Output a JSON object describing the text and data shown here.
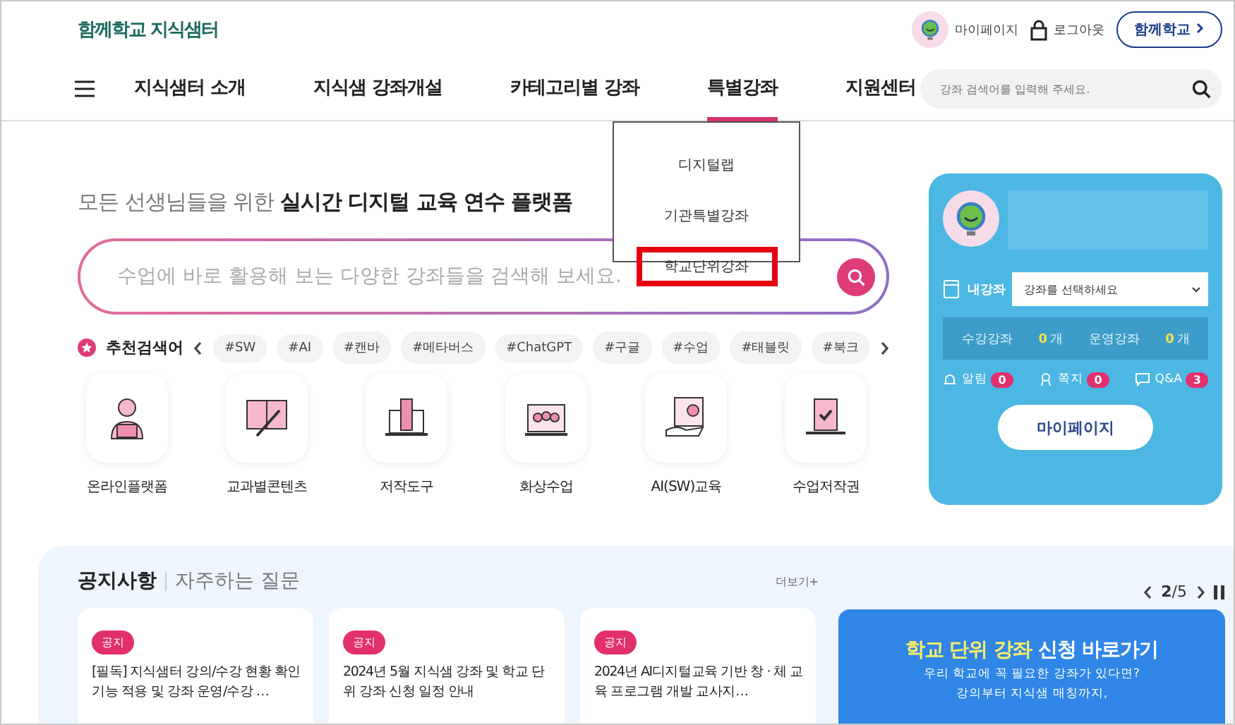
{
  "header": {
    "logo": "함께학교 지식샘터",
    "links": [
      {
        "label": "마이페이지",
        "kind": "avatar"
      },
      {
        "label": "로그아웃",
        "kind": "lock"
      }
    ],
    "partner_button": "함께학교"
  },
  "nav": {
    "items": [
      {
        "label": "지식샘터 소개",
        "selected": false
      },
      {
        "label": "지식샘 강좌개설",
        "selected": false
      },
      {
        "label": "카테고리별 강좌",
        "selected": false
      },
      {
        "label": "특별강좌",
        "selected": true
      },
      {
        "label": "지원센터",
        "selected": false
      }
    ],
    "search": {
      "placeholder": "강좌 검색어를 입력해 주세요."
    }
  },
  "dropdown": {
    "items": [
      {
        "label": "디지털랩",
        "highlighted": false
      },
      {
        "label": "기관특별강좌",
        "highlighted": false
      },
      {
        "label": "학교단위강좌",
        "highlighted": true
      }
    ]
  },
  "hero": {
    "headline": "모든 선생님들을 위한 **실시간 디지털 교육 연수 플랫폼**",
    "search": {
      "placeholder": "수업에 바로 활용해 보는 다양한 강좌들을 검색해 보세요."
    },
    "tags_label": "추천검색어",
    "tags": [
      "#SW",
      "#AI",
      "#캔바",
      "#메타버스",
      "#ChatGPT",
      "#구글",
      "#수업",
      "#태블릿",
      "#북크"
    ]
  },
  "categories": [
    {
      "label": "온라인플랫폼"
    },
    {
      "label": "교과별콘텐츠"
    },
    {
      "label": "저작도구"
    },
    {
      "label": "화상수업"
    },
    {
      "label": "AI(SW)교육"
    },
    {
      "label": "수업저작권"
    }
  ],
  "my_card": {
    "course_label": "내강좌",
    "course_select": "강좌를 선택하세요",
    "stats": [
      {
        "label": "수강강좌",
        "count": "0",
        "unit": "개"
      },
      {
        "label": "운영강좌",
        "count": "0",
        "unit": "개"
      }
    ],
    "counters": [
      {
        "label": "알림",
        "count": "0",
        "kind": "bell"
      },
      {
        "label": "쪽지",
        "count": "0",
        "kind": "note"
      },
      {
        "label": "Q&A",
        "count": "3",
        "kind": "chat"
      }
    ],
    "button": "마이페이지"
  },
  "notice": {
    "tabs": [
      {
        "label": "공지사항",
        "selected": true
      },
      {
        "label": "자주하는 질문",
        "selected": false
      }
    ],
    "more": "더보기+",
    "cards": [
      {
        "badge": "공지",
        "title": "[필독] 지식샘터 강의/수강 현황 확인 기능 적용 및 강좌 운영/수강 …"
      },
      {
        "badge": "공지",
        "title": "2024년 5월 지식샘 강좌 및 학교 단위 강좌 신청 일정 안내"
      },
      {
        "badge": "공지",
        "title": "2024년 AI디지털교육 기반 창 · 체 교육 프로그램 개발 교사지…"
      }
    ],
    "pager": {
      "current": "2",
      "total": "/5"
    },
    "banner": {
      "title_highlight": "학교 단위 강좌",
      "title_rest": "신청 바로가기",
      "lines": [
        "우리 학교에 꼭 필요한 강좌가 있다면?",
        "강의부터 지식샘 매칭까지,"
      ]
    }
  }
}
